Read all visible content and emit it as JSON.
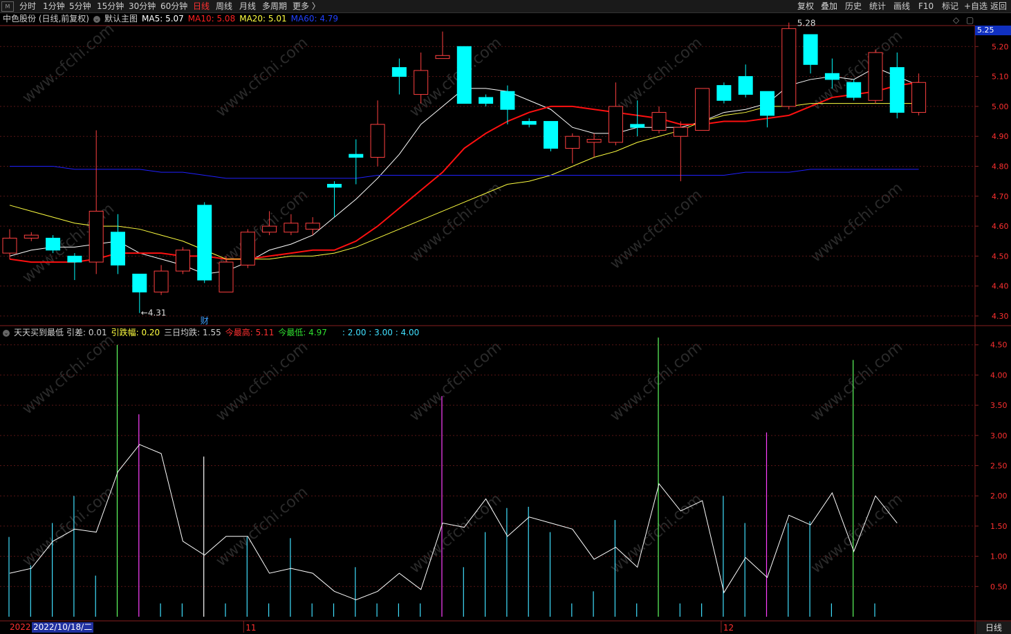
{
  "toolbar": {
    "left_items": [
      "分时",
      "1分钟",
      "5分钟",
      "15分钟",
      "30分钟",
      "60分钟",
      "日线",
      "周线",
      "月线",
      "多周期",
      "更多 〉"
    ],
    "active_index": 6,
    "right_items": [
      "复权",
      "叠加",
      "历史",
      "统计",
      "画线",
      "F10",
      "标记",
      "+自选",
      "返回"
    ]
  },
  "main_legend": {
    "stock": "中色股份 (日线,前复权)",
    "template": "默认主图",
    "ma5": "MA5: 5.07",
    "ma10": "MA10: 5.08",
    "ma20": "MA20: 5.01",
    "ma60": "MA60: 4.79"
  },
  "sub_legend": {
    "name": "天天买到最低",
    "yincha": "引差: 0.01",
    "yiedie": "引跌幅: 0.20",
    "sanri": "三日均跌: 1.55",
    "high": "今最高: 5.11",
    "low": "今最低: 4.97",
    "ratios": ": 2.00 : 3.00 : 4.00"
  },
  "current_price": "5.25",
  "high_mark": "5.28",
  "low_mark": "4.31",
  "finance_mark": "财",
  "bottom_tab": "日线",
  "date_prefix": "2022",
  "date_tag": "2022/10/18/二",
  "month_labels": [
    "11",
    "12"
  ],
  "watermark": "www.cfchi.com",
  "colors": {
    "up": "#ff4040",
    "down": "#00ffff",
    "ma5": "#ffffff",
    "ma10": "#ff1010",
    "ma20": "#ffff40",
    "ma60": "#2020ff"
  },
  "chart_data": [
    {
      "type": "candlestick",
      "title": "中色股份 (日线,前复权)",
      "y_ticks": [
        "5.20",
        "5.10",
        "5.00",
        "4.90",
        "4.80",
        "4.70",
        "4.60",
        "4.50",
        "4.40",
        "4.30"
      ],
      "ylim": [
        4.27,
        5.27
      ],
      "candles": [
        {
          "o": 4.51,
          "c": 4.56,
          "h": 4.59,
          "l": 4.49
        },
        {
          "o": 4.56,
          "c": 4.57,
          "h": 4.58,
          "l": 4.55
        },
        {
          "o": 4.56,
          "c": 4.52,
          "h": 4.57,
          "l": 4.51
        },
        {
          "o": 4.5,
          "c": 4.48,
          "h": 4.51,
          "l": 4.42
        },
        {
          "o": 4.48,
          "c": 4.65,
          "h": 4.92,
          "l": 4.44
        },
        {
          "o": 4.58,
          "c": 4.47,
          "h": 4.64,
          "l": 4.44
        },
        {
          "o": 4.44,
          "c": 4.38,
          "h": 4.44,
          "l": 4.31
        },
        {
          "o": 4.38,
          "c": 4.45,
          "h": 4.47,
          "l": 4.37
        },
        {
          "o": 4.45,
          "c": 4.52,
          "h": 4.53,
          "l": 4.44
        },
        {
          "o": 4.67,
          "c": 4.42,
          "h": 4.68,
          "l": 4.41
        },
        {
          "o": 4.38,
          "c": 4.48,
          "h": 4.5,
          "l": 4.38
        },
        {
          "o": 4.47,
          "c": 4.58,
          "h": 4.59,
          "l": 4.46
        },
        {
          "o": 4.58,
          "c": 4.6,
          "h": 4.65,
          "l": 4.57
        },
        {
          "o": 4.58,
          "c": 4.61,
          "h": 4.64,
          "l": 4.57
        },
        {
          "o": 4.59,
          "c": 4.61,
          "h": 4.63,
          "l": 4.57
        },
        {
          "o": 4.74,
          "c": 4.73,
          "h": 4.75,
          "l": 4.63
        },
        {
          "o": 4.84,
          "c": 4.83,
          "h": 4.89,
          "l": 4.74
        },
        {
          "o": 4.83,
          "c": 4.94,
          "h": 5.02,
          "l": 4.8
        },
        {
          "o": 5.13,
          "c": 5.1,
          "h": 5.16,
          "l": 5.04
        },
        {
          "o": 5.04,
          "c": 5.12,
          "h": 5.18,
          "l": 5.01
        },
        {
          "o": 5.16,
          "c": 5.17,
          "h": 5.25,
          "l": 5.16
        },
        {
          "o": 5.2,
          "c": 5.01,
          "h": 5.2,
          "l": 5.01
        },
        {
          "o": 5.03,
          "c": 5.01,
          "h": 5.04,
          "l": 5.0
        },
        {
          "o": 5.05,
          "c": 4.99,
          "h": 5.07,
          "l": 4.94
        },
        {
          "o": 4.95,
          "c": 4.94,
          "h": 4.96,
          "l": 4.93
        },
        {
          "o": 4.95,
          "c": 4.86,
          "h": 4.95,
          "l": 4.85
        },
        {
          "o": 4.86,
          "c": 4.9,
          "h": 4.91,
          "l": 4.81
        },
        {
          "o": 4.88,
          "c": 4.89,
          "h": 4.91,
          "l": 4.83
        },
        {
          "o": 4.88,
          "c": 5.0,
          "h": 5.08,
          "l": 4.87
        },
        {
          "o": 4.94,
          "c": 4.93,
          "h": 5.02,
          "l": 4.9
        },
        {
          "o": 4.92,
          "c": 4.98,
          "h": 5.0,
          "l": 4.91
        },
        {
          "o": 4.9,
          "c": 4.93,
          "h": 4.95,
          "l": 4.75
        },
        {
          "o": 4.92,
          "c": 5.06,
          "h": 5.06,
          "l": 4.92
        },
        {
          "o": 5.07,
          "c": 5.02,
          "h": 5.08,
          "l": 5.01
        },
        {
          "o": 5.1,
          "c": 5.04,
          "h": 5.14,
          "l": 5.03
        },
        {
          "o": 5.05,
          "c": 4.97,
          "h": 5.05,
          "l": 4.93
        },
        {
          "o": 5.0,
          "c": 5.26,
          "h": 5.28,
          "l": 4.99
        },
        {
          "o": 5.24,
          "c": 5.14,
          "h": 5.24,
          "l": 5.11
        },
        {
          "o": 5.11,
          "c": 5.09,
          "h": 5.16,
          "l": 5.06
        },
        {
          "o": 5.08,
          "c": 5.03,
          "h": 5.09,
          "l": 5.02
        },
        {
          "o": 5.02,
          "c": 5.18,
          "h": 5.19,
          "l": 5.01
        },
        {
          "o": 5.13,
          "c": 4.98,
          "h": 5.18,
          "l": 4.96
        },
        {
          "o": 4.98,
          "c": 5.08,
          "h": 5.11,
          "l": 4.97
        }
      ],
      "series": [
        {
          "name": "MA5",
          "values": [
            4.5,
            4.52,
            4.53,
            4.53,
            4.54,
            4.55,
            4.51,
            4.49,
            4.47,
            4.44,
            4.45,
            4.48,
            4.52,
            4.54,
            4.57,
            4.63,
            4.69,
            4.76,
            4.84,
            4.94,
            5.0,
            5.06,
            5.06,
            5.05,
            5.02,
            4.99,
            4.93,
            4.91,
            4.91,
            4.93,
            4.93,
            4.93,
            4.95,
            4.98,
            4.99,
            5.01,
            5.07,
            5.09,
            5.1,
            5.09,
            5.13,
            5.1,
            5.07
          ]
        },
        {
          "name": "MA10",
          "values": [
            4.49,
            4.48,
            4.48,
            4.48,
            4.49,
            4.51,
            4.51,
            4.51,
            4.5,
            4.5,
            4.49,
            4.49,
            4.5,
            4.51,
            4.52,
            4.52,
            4.55,
            4.6,
            4.66,
            4.72,
            4.78,
            4.86,
            4.91,
            4.95,
            4.98,
            5.0,
            5.0,
            4.99,
            4.98,
            4.97,
            4.96,
            4.94,
            4.94,
            4.95,
            4.95,
            4.96,
            4.97,
            5.0,
            5.03,
            5.04,
            5.05,
            5.07,
            5.08
          ]
        },
        {
          "name": "MA20",
          "values": [
            4.67,
            4.65,
            4.63,
            4.61,
            4.6,
            4.6,
            4.59,
            4.57,
            4.55,
            4.52,
            4.49,
            4.49,
            4.49,
            4.5,
            4.5,
            4.51,
            4.53,
            4.56,
            4.59,
            4.62,
            4.65,
            4.68,
            4.71,
            4.74,
            4.75,
            4.77,
            4.8,
            4.83,
            4.85,
            4.88,
            4.9,
            4.92,
            4.95,
            4.97,
            4.98,
            5.0,
            5.0,
            5.01,
            5.01,
            5.01,
            5.01,
            5.01,
            5.01
          ]
        },
        {
          "name": "MA60",
          "values": [
            4.8,
            4.8,
            4.8,
            4.79,
            4.79,
            4.79,
            4.79,
            4.78,
            4.78,
            4.77,
            4.76,
            4.76,
            4.76,
            4.76,
            4.76,
            4.76,
            4.76,
            4.77,
            4.77,
            4.77,
            4.77,
            4.77,
            4.77,
            4.77,
            4.77,
            4.77,
            4.77,
            4.77,
            4.77,
            4.77,
            4.77,
            4.77,
            4.77,
            4.77,
            4.78,
            4.78,
            4.78,
            4.79,
            4.79,
            4.79,
            4.79,
            4.79,
            4.79
          ]
        }
      ]
    },
    {
      "type": "bar",
      "title": "天天买到最低",
      "y_ticks": [
        "4.50",
        "4.00",
        "3.50",
        "3.00",
        "2.50",
        "2.00",
        "1.50",
        "1.00",
        "0.50"
      ],
      "ylim": [
        0,
        4.6
      ],
      "bars": [
        1.32,
        0.85,
        1.55,
        2.0,
        0.68,
        4.5,
        3.35,
        0.22,
        0.22,
        2.65,
        0.22,
        1.32,
        0.22,
        1.3,
        0.22,
        0.22,
        0.82,
        0.22,
        0.22,
        0.22,
        3.65,
        0.82,
        1.4,
        1.8,
        1.82,
        1.4,
        0.22,
        0.42,
        1.6,
        0.22,
        4.62,
        0.22,
        0.22,
        2.0,
        1.55,
        3.05,
        1.55,
        1.58,
        0.22,
        4.25,
        0.22
      ],
      "bar_colors": [
        "cyan",
        "cyan",
        "cyan",
        "cyan",
        "cyan",
        "green",
        "magenta",
        "cyan",
        "cyan",
        "white",
        "cyan",
        "cyan",
        "cyan",
        "cyan",
        "cyan",
        "cyan",
        "cyan",
        "cyan",
        "cyan",
        "cyan",
        "magenta",
        "cyan",
        "cyan",
        "cyan",
        "cyan",
        "cyan",
        "cyan",
        "cyan",
        "cyan",
        "cyan",
        "green",
        "cyan",
        "cyan",
        "cyan",
        "cyan",
        "magenta",
        "cyan",
        "cyan",
        "cyan",
        "green",
        "cyan"
      ],
      "line": [
        0.72,
        0.8,
        1.25,
        1.45,
        1.4,
        2.4,
        2.85,
        2.7,
        1.25,
        1.02,
        1.33,
        1.33,
        0.72,
        0.8,
        0.72,
        0.42,
        0.28,
        0.42,
        0.72,
        0.45,
        1.55,
        1.48,
        1.95,
        1.33,
        1.65,
        1.55,
        1.45,
        0.95,
        1.15,
        0.82,
        2.2,
        1.75,
        1.92,
        0.4,
        0.98,
        0.65,
        1.68,
        1.52,
        2.05,
        1.08,
        2.0,
        1.55
      ]
    }
  ]
}
